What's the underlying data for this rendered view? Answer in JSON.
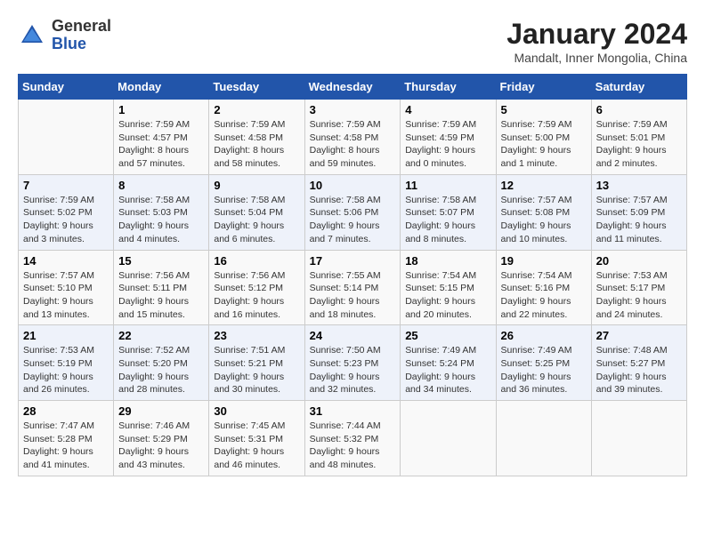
{
  "logo": {
    "text_general": "General",
    "text_blue": "Blue"
  },
  "header": {
    "title": "January 2024",
    "subtitle": "Mandalt, Inner Mongolia, China"
  },
  "days_of_week": [
    "Sunday",
    "Monday",
    "Tuesday",
    "Wednesday",
    "Thursday",
    "Friday",
    "Saturday"
  ],
  "weeks": [
    [
      {
        "day": "",
        "info": ""
      },
      {
        "day": "1",
        "info": "Sunrise: 7:59 AM\nSunset: 4:57 PM\nDaylight: 8 hours\nand 57 minutes."
      },
      {
        "day": "2",
        "info": "Sunrise: 7:59 AM\nSunset: 4:58 PM\nDaylight: 8 hours\nand 58 minutes."
      },
      {
        "day": "3",
        "info": "Sunrise: 7:59 AM\nSunset: 4:58 PM\nDaylight: 8 hours\nand 59 minutes."
      },
      {
        "day": "4",
        "info": "Sunrise: 7:59 AM\nSunset: 4:59 PM\nDaylight: 9 hours\nand 0 minutes."
      },
      {
        "day": "5",
        "info": "Sunrise: 7:59 AM\nSunset: 5:00 PM\nDaylight: 9 hours\nand 1 minute."
      },
      {
        "day": "6",
        "info": "Sunrise: 7:59 AM\nSunset: 5:01 PM\nDaylight: 9 hours\nand 2 minutes."
      }
    ],
    [
      {
        "day": "7",
        "info": "Sunrise: 7:59 AM\nSunset: 5:02 PM\nDaylight: 9 hours\nand 3 minutes."
      },
      {
        "day": "8",
        "info": "Sunrise: 7:58 AM\nSunset: 5:03 PM\nDaylight: 9 hours\nand 4 minutes."
      },
      {
        "day": "9",
        "info": "Sunrise: 7:58 AM\nSunset: 5:04 PM\nDaylight: 9 hours\nand 6 minutes."
      },
      {
        "day": "10",
        "info": "Sunrise: 7:58 AM\nSunset: 5:06 PM\nDaylight: 9 hours\nand 7 minutes."
      },
      {
        "day": "11",
        "info": "Sunrise: 7:58 AM\nSunset: 5:07 PM\nDaylight: 9 hours\nand 8 minutes."
      },
      {
        "day": "12",
        "info": "Sunrise: 7:57 AM\nSunset: 5:08 PM\nDaylight: 9 hours\nand 10 minutes."
      },
      {
        "day": "13",
        "info": "Sunrise: 7:57 AM\nSunset: 5:09 PM\nDaylight: 9 hours\nand 11 minutes."
      }
    ],
    [
      {
        "day": "14",
        "info": "Sunrise: 7:57 AM\nSunset: 5:10 PM\nDaylight: 9 hours\nand 13 minutes."
      },
      {
        "day": "15",
        "info": "Sunrise: 7:56 AM\nSunset: 5:11 PM\nDaylight: 9 hours\nand 15 minutes."
      },
      {
        "day": "16",
        "info": "Sunrise: 7:56 AM\nSunset: 5:12 PM\nDaylight: 9 hours\nand 16 minutes."
      },
      {
        "day": "17",
        "info": "Sunrise: 7:55 AM\nSunset: 5:14 PM\nDaylight: 9 hours\nand 18 minutes."
      },
      {
        "day": "18",
        "info": "Sunrise: 7:54 AM\nSunset: 5:15 PM\nDaylight: 9 hours\nand 20 minutes."
      },
      {
        "day": "19",
        "info": "Sunrise: 7:54 AM\nSunset: 5:16 PM\nDaylight: 9 hours\nand 22 minutes."
      },
      {
        "day": "20",
        "info": "Sunrise: 7:53 AM\nSunset: 5:17 PM\nDaylight: 9 hours\nand 24 minutes."
      }
    ],
    [
      {
        "day": "21",
        "info": "Sunrise: 7:53 AM\nSunset: 5:19 PM\nDaylight: 9 hours\nand 26 minutes."
      },
      {
        "day": "22",
        "info": "Sunrise: 7:52 AM\nSunset: 5:20 PM\nDaylight: 9 hours\nand 28 minutes."
      },
      {
        "day": "23",
        "info": "Sunrise: 7:51 AM\nSunset: 5:21 PM\nDaylight: 9 hours\nand 30 minutes."
      },
      {
        "day": "24",
        "info": "Sunrise: 7:50 AM\nSunset: 5:23 PM\nDaylight: 9 hours\nand 32 minutes."
      },
      {
        "day": "25",
        "info": "Sunrise: 7:49 AM\nSunset: 5:24 PM\nDaylight: 9 hours\nand 34 minutes."
      },
      {
        "day": "26",
        "info": "Sunrise: 7:49 AM\nSunset: 5:25 PM\nDaylight: 9 hours\nand 36 minutes."
      },
      {
        "day": "27",
        "info": "Sunrise: 7:48 AM\nSunset: 5:27 PM\nDaylight: 9 hours\nand 39 minutes."
      }
    ],
    [
      {
        "day": "28",
        "info": "Sunrise: 7:47 AM\nSunset: 5:28 PM\nDaylight: 9 hours\nand 41 minutes."
      },
      {
        "day": "29",
        "info": "Sunrise: 7:46 AM\nSunset: 5:29 PM\nDaylight: 9 hours\nand 43 minutes."
      },
      {
        "day": "30",
        "info": "Sunrise: 7:45 AM\nSunset: 5:31 PM\nDaylight: 9 hours\nand 46 minutes."
      },
      {
        "day": "31",
        "info": "Sunrise: 7:44 AM\nSunset: 5:32 PM\nDaylight: 9 hours\nand 48 minutes."
      },
      {
        "day": "",
        "info": ""
      },
      {
        "day": "",
        "info": ""
      },
      {
        "day": "",
        "info": ""
      }
    ]
  ]
}
